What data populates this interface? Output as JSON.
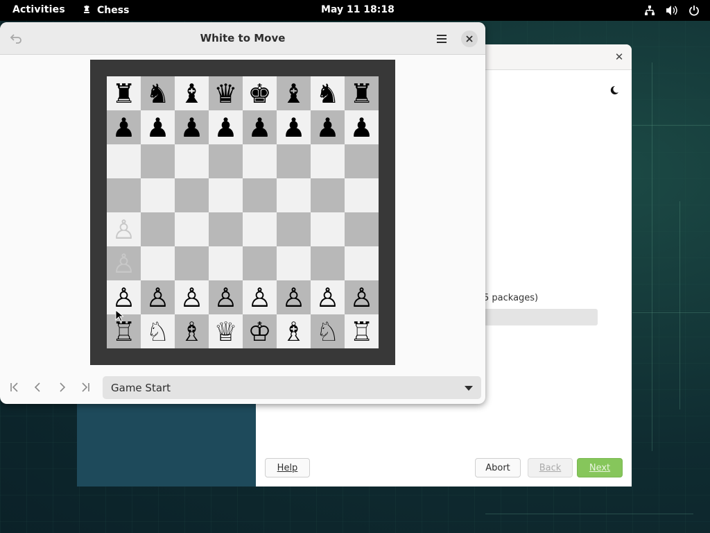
{
  "topbar": {
    "activities": "Activities",
    "app_name": "Chess",
    "clock": "May 11  18:18",
    "tray_icons": [
      "network-icon",
      "volume-icon",
      "power-icon"
    ]
  },
  "installer": {
    "packages_text": "5 packages)",
    "buttons": {
      "help": "Help",
      "abort": "Abort",
      "back": "Back",
      "next": "Next"
    },
    "colors": {
      "sidebar": "#1e4a5b",
      "next": "#86c65b"
    }
  },
  "chess": {
    "title": "White to Move",
    "move_select": "Game Start",
    "board": [
      [
        "♜",
        "♞",
        "♝",
        "♛",
        "♚",
        "♝",
        "♞",
        "♜"
      ],
      [
        "♟",
        "♟",
        "♟",
        "♟",
        "♟",
        "♟",
        "♟",
        "♟"
      ],
      [
        "",
        "",
        "",
        "",
        "",
        "",
        "",
        ""
      ],
      [
        "",
        "",
        "",
        "",
        "",
        "",
        "",
        ""
      ],
      [
        "♙",
        "",
        "",
        "",
        "",
        "",
        "",
        ""
      ],
      [
        "♙",
        "",
        "",
        "",
        "",
        "",
        "",
        ""
      ],
      [
        "♙",
        "♙",
        "♙",
        "♙",
        "♙",
        "♙",
        "♙",
        "♙"
      ],
      [
        "♖",
        "♘",
        "♗",
        "♕",
        "♔",
        "♗",
        "♘",
        "♖"
      ]
    ],
    "ghost_squares": [
      "a4",
      "a3"
    ],
    "nav_icons": [
      "first-move-icon",
      "previous-move-icon",
      "next-move-icon",
      "last-move-icon"
    ]
  }
}
